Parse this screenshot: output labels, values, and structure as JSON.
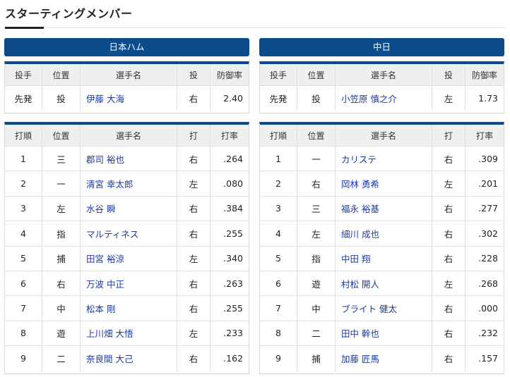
{
  "page_title": "スターティングメンバー",
  "colors": {
    "team_bar": "#0c4b8c",
    "player_link": "#1a3aa5"
  },
  "teams": [
    {
      "name": "日本ハム",
      "pitcher_headers": [
        "投手",
        "位置",
        "選手名",
        "投",
        "防御率"
      ],
      "pitcher": {
        "role": "先発",
        "pos": "投",
        "name": "伊藤 大海",
        "hand": "右",
        "era": "2.40"
      },
      "batter_headers": [
        "打順",
        "位置",
        "選手名",
        "打",
        "打率"
      ],
      "batters": [
        {
          "order": "1",
          "pos": "三",
          "name": "郡司 裕也",
          "hand": "右",
          "avg": ".264"
        },
        {
          "order": "2",
          "pos": "一",
          "name": "清宮 幸太郎",
          "hand": "左",
          "avg": ".080"
        },
        {
          "order": "3",
          "pos": "左",
          "name": "水谷 瞬",
          "hand": "右",
          "avg": ".384"
        },
        {
          "order": "4",
          "pos": "指",
          "name": "マルティネス",
          "hand": "右",
          "avg": ".255"
        },
        {
          "order": "5",
          "pos": "捕",
          "name": "田宮 裕涼",
          "hand": "左",
          "avg": ".340"
        },
        {
          "order": "6",
          "pos": "右",
          "name": "万波 中正",
          "hand": "右",
          "avg": ".263"
        },
        {
          "order": "7",
          "pos": "中",
          "name": "松本 剛",
          "hand": "右",
          "avg": ".255"
        },
        {
          "order": "8",
          "pos": "遊",
          "name": "上川畑 大悟",
          "hand": "左",
          "avg": ".233"
        },
        {
          "order": "9",
          "pos": "二",
          "name": "奈良間 大己",
          "hand": "右",
          "avg": ".162"
        }
      ]
    },
    {
      "name": "中日",
      "pitcher_headers": [
        "投手",
        "位置",
        "選手名",
        "投",
        "防御率"
      ],
      "pitcher": {
        "role": "先発",
        "pos": "投",
        "name": "小笠原 慎之介",
        "hand": "左",
        "era": "1.73"
      },
      "batter_headers": [
        "打順",
        "位置",
        "選手名",
        "打",
        "打率"
      ],
      "batters": [
        {
          "order": "1",
          "pos": "一",
          "name": "カリステ",
          "hand": "右",
          "avg": ".309"
        },
        {
          "order": "2",
          "pos": "右",
          "name": "岡林 勇希",
          "hand": "左",
          "avg": ".201"
        },
        {
          "order": "3",
          "pos": "三",
          "name": "福永 裕基",
          "hand": "右",
          "avg": ".277"
        },
        {
          "order": "4",
          "pos": "左",
          "name": "細川 成也",
          "hand": "右",
          "avg": ".302"
        },
        {
          "order": "5",
          "pos": "指",
          "name": "中田 翔",
          "hand": "右",
          "avg": ".228"
        },
        {
          "order": "6",
          "pos": "遊",
          "name": "村松 開人",
          "hand": "左",
          "avg": ".268"
        },
        {
          "order": "7",
          "pos": "中",
          "name": "ブライト 健太",
          "hand": "右",
          "avg": ".000"
        },
        {
          "order": "8",
          "pos": "二",
          "name": "田中 幹也",
          "hand": "右",
          "avg": ".232"
        },
        {
          "order": "9",
          "pos": "捕",
          "name": "加藤 匠馬",
          "hand": "右",
          "avg": ".157"
        }
      ]
    }
  ]
}
